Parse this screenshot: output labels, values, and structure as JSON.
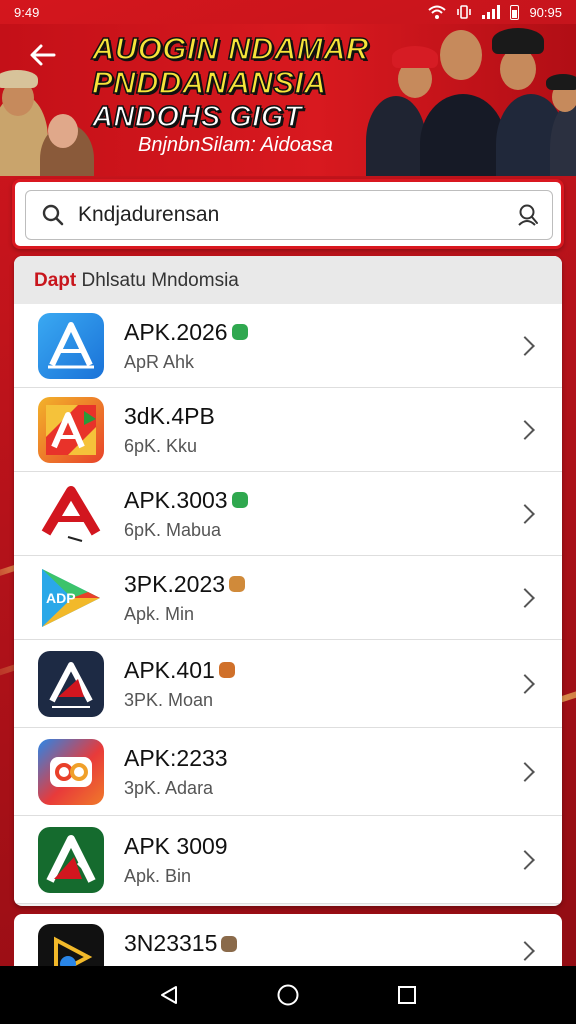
{
  "status_bar": {
    "time": "9:49",
    "clock_right": "90:95"
  },
  "header": {
    "title_lines": [
      "AUOGIN NDAMAR",
      "PNDDANANSIA",
      "ANDOHS GIGT"
    ],
    "subtitle": "BnjnbnSilam: Aidoasa"
  },
  "search": {
    "value": "Kndjadurensan"
  },
  "section": {
    "accent": "Dapt",
    "label": " Dhlsatu Mndomsia"
  },
  "apps": [
    {
      "title": "APK.2026",
      "subtitle": "ApR Ahk",
      "badge_color": "#2fa84f",
      "icon": "a-blue-icon"
    },
    {
      "title": "3dK.4PB",
      "subtitle": "6pK. Kku",
      "badge_color": "",
      "icon": "a-red-yellow-icon"
    },
    {
      "title": "APK.3003",
      "subtitle": "6pK. Mabua",
      "badge_color": "#2fa84f",
      "icon": "a-red-white-icon"
    },
    {
      "title": "3PK.2023",
      "subtitle": "Apk. Min",
      "badge_color": "#d08a3a",
      "icon": "play-store-icon"
    },
    {
      "title": "APK.401",
      "subtitle": "3PK. Moan",
      "badge_color": "#d0702a",
      "icon": "a-navy-icon"
    },
    {
      "title": "APK:2233",
      "subtitle": "3pK. Adara",
      "badge_color": "",
      "icon": "camera-bubble-icon"
    },
    {
      "title": "APK 3009",
      "subtitle": "Apk. Bin",
      "badge_color": "",
      "icon": "a-green-icon"
    }
  ],
  "partial_item": {
    "title": "3N23315",
    "badge_color": "#8a6a4a",
    "icon": "video-icon"
  },
  "colors": {
    "brand_red": "#c8161d",
    "banner_yellow": "#f6e43a"
  }
}
